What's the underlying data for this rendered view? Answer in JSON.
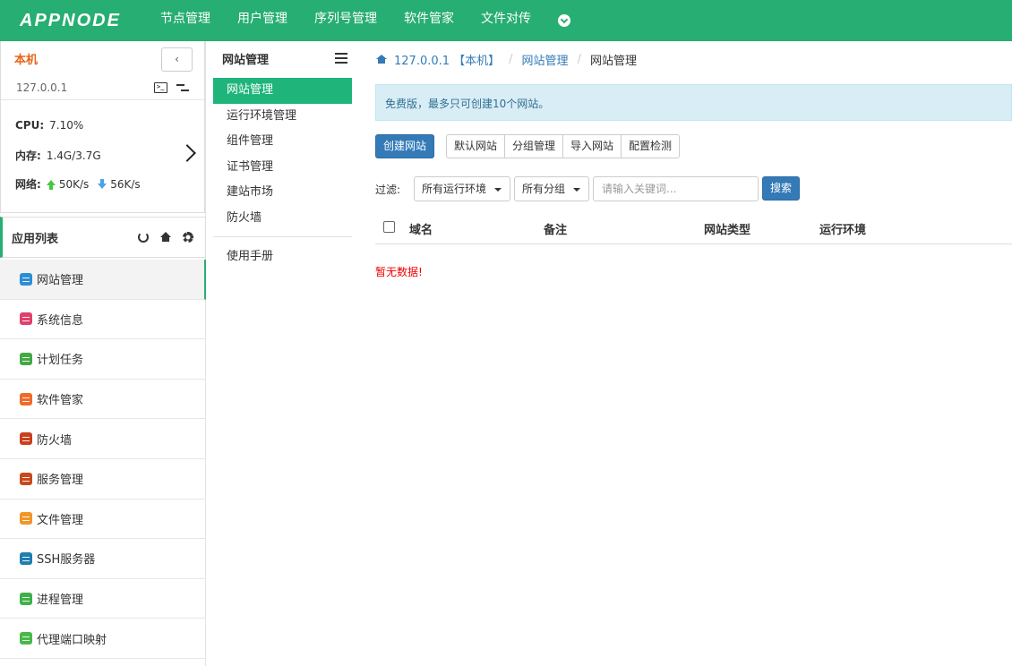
{
  "topbar": {
    "logo": "APPNODE",
    "nav": [
      "节点管理",
      "用户管理",
      "序列号管理",
      "软件管家",
      "文件对传"
    ],
    "more_icon": "chevron-down-circle-icon"
  },
  "node": {
    "name": "本机",
    "ip": "127.0.0.1",
    "collapse_label": "‹",
    "cpu_label": "CPU:",
    "cpu_value": "7.10%",
    "mem_label": "内存:",
    "mem_value": "1.4G/3.7G",
    "net_label": "网络:",
    "net_up": "50K/s",
    "net_down": "56K/s"
  },
  "apps": {
    "title": "应用列表",
    "items": [
      {
        "label": "网站管理",
        "color": "#2a8fd4",
        "active": true
      },
      {
        "label": "系统信息",
        "color": "#e0406a"
      },
      {
        "label": "计划任务",
        "color": "#44a845"
      },
      {
        "label": "软件管家",
        "color": "#f06a2a"
      },
      {
        "label": "防火墙",
        "color": "#c8401e"
      },
      {
        "label": "服务管理",
        "color": "#c74a1f"
      },
      {
        "label": "文件管理",
        "color": "#f0962a"
      },
      {
        "label": "SSH服务器",
        "color": "#1f7fb0"
      },
      {
        "label": "进程管理",
        "color": "#3fb04a"
      },
      {
        "label": "代理端口映射",
        "color": "#48b848"
      }
    ]
  },
  "submenu": {
    "title": "网站管理",
    "items": [
      "网站管理",
      "运行环境管理",
      "组件管理",
      "证书管理",
      "建站市场",
      "防火墙"
    ],
    "manual": "使用手册"
  },
  "breadcrumb": {
    "host": "127.0.0.1 【本机】",
    "section": "网站管理",
    "current": "网站管理"
  },
  "notice": "免费版，最多只可创建10个网站。",
  "toolbar": {
    "create": "创建网站",
    "group": [
      "默认网站",
      "分组管理",
      "导入网站",
      "配置检测"
    ]
  },
  "filter": {
    "label": "过滤:",
    "env": "所有运行环境",
    "group": "所有分组",
    "placeholder": "请输入关键词...",
    "search": "搜索"
  },
  "table": {
    "columns": [
      "域名",
      "备注",
      "网站类型",
      "运行环境"
    ],
    "empty": "暂无数据!"
  }
}
